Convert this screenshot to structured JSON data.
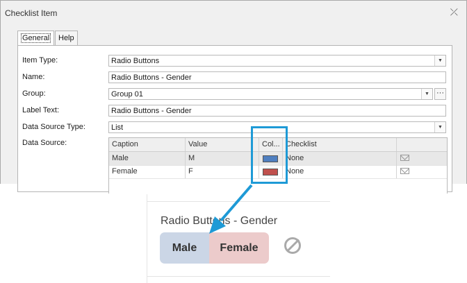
{
  "window": {
    "title": "Checklist Item",
    "close_glyph": "⤫"
  },
  "tabs": [
    {
      "label": "General"
    },
    {
      "label": "Help"
    }
  ],
  "form": {
    "item_type": {
      "label": "Item Type:",
      "value": "Radio Buttons"
    },
    "name": {
      "label": "Name:",
      "value": "Radio Buttons - Gender"
    },
    "group": {
      "label": "Group:",
      "value": "Group 01",
      "ellipsis": "···"
    },
    "label_text": {
      "label": "Label Text:",
      "value": "Radio Buttons - Gender"
    },
    "data_source_type": {
      "label": "Data Source Type:",
      "value": "List"
    },
    "data_source": {
      "label": "Data Source:"
    }
  },
  "grid": {
    "columns": [
      "Caption",
      "Value",
      "Col...",
      "Checklist"
    ],
    "rows": [
      {
        "caption": "Male",
        "value": "M",
        "color": "#4f7fc0",
        "checklist": "None"
      },
      {
        "caption": "Female",
        "value": "F",
        "color": "#c0504d",
        "checklist": "None"
      }
    ]
  },
  "preview": {
    "label": "Radio Buttons - Gender",
    "options": [
      "Male",
      "Female"
    ],
    "male_bg": "#cbd6e6",
    "female_bg": "#eccbcb"
  },
  "accent_color": "#1e9ad6"
}
